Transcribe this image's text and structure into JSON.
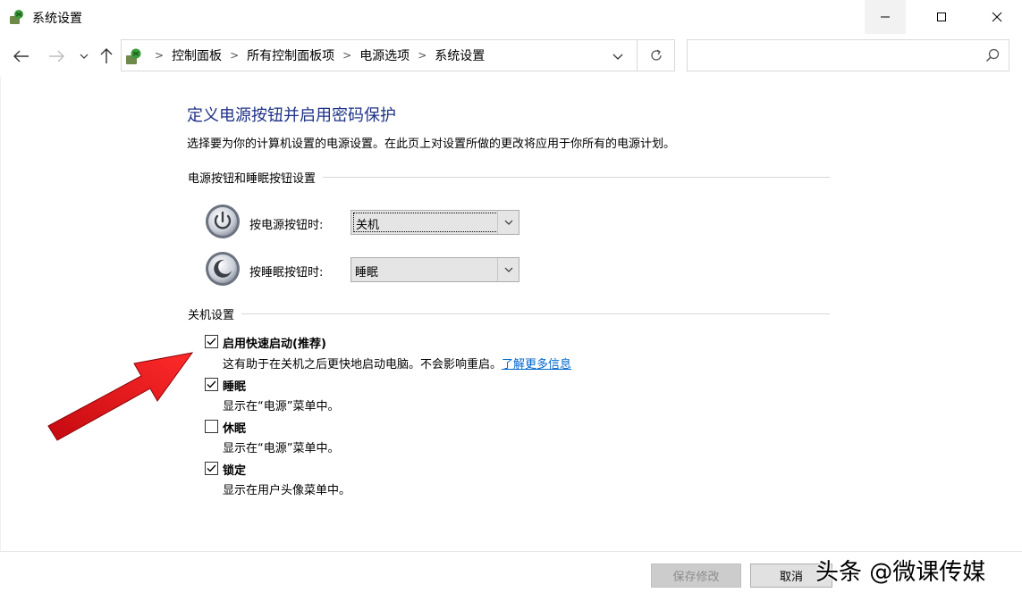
{
  "window": {
    "title": "系统设置",
    "controls": {
      "minimize": "minimize",
      "maximize": "maximize",
      "close": "close"
    }
  },
  "address_bar": {
    "crumbs": [
      "控制面板",
      "所有控制面板项",
      "电源选项",
      "系统设置"
    ],
    "search_placeholder": ""
  },
  "page": {
    "title": "定义电源按钮并启用密码保护",
    "description": "选择要为你的计算机设置的电源设置。在此页上对设置所做的更改将应用于你所有的电源计划。"
  },
  "power_buttons": {
    "header": "电源按钮和睡眠按钮设置",
    "power": {
      "label": "按电源按钮时:",
      "value": "关机"
    },
    "sleep": {
      "label": "按睡眠按钮时:",
      "value": "睡眠"
    }
  },
  "shutdown": {
    "header": "关机设置",
    "items": [
      {
        "label": "启用快速启动(推荐)",
        "desc": "这有助于在关机之后更快地启动电脑。不会影响重启。",
        "link": "了解更多信息",
        "checked": true
      },
      {
        "label": "睡眠",
        "desc": "显示在“电源”菜单中。",
        "checked": true
      },
      {
        "label": "休眠",
        "desc": "显示在“电源”菜单中。",
        "checked": false
      },
      {
        "label": "锁定",
        "desc": "显示在用户头像菜单中。",
        "checked": true
      }
    ]
  },
  "footer": {
    "save": "保存修改",
    "cancel": "取消"
  },
  "watermark": "头条 @微课传媒",
  "colors": {
    "title_blue": "#1e3287",
    "link_blue": "#0066cc",
    "arrow_red": "#e8181c"
  }
}
